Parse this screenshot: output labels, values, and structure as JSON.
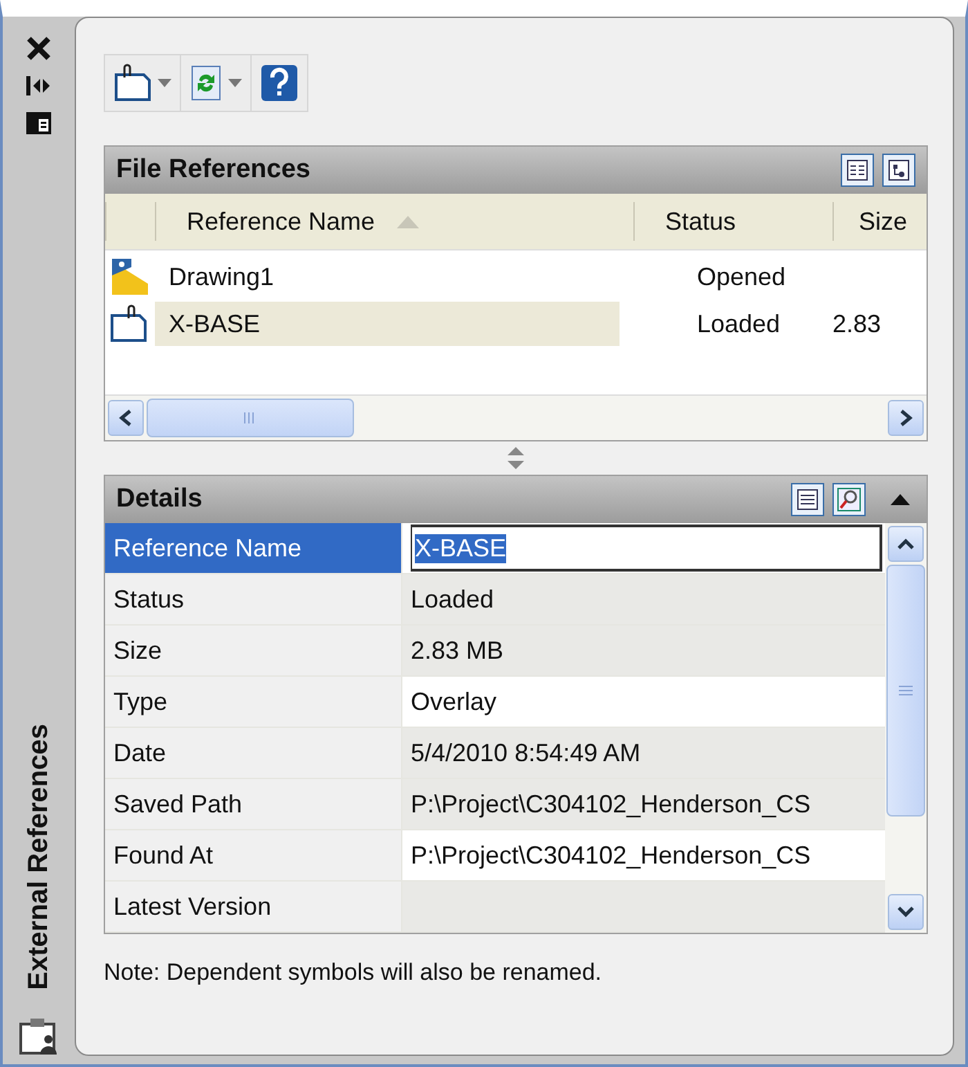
{
  "palette": {
    "title": "External References"
  },
  "toolbar": {
    "buttons": [
      {
        "kind": "attach",
        "dropdown": true
      },
      {
        "kind": "refresh",
        "dropdown": true
      },
      {
        "kind": "help",
        "dropdown": false
      }
    ]
  },
  "file_references": {
    "title": "File References",
    "columns": [
      {
        "label": "Reference Name",
        "sorted": true
      },
      {
        "label": "Status",
        "sorted": false
      },
      {
        "label": "Size",
        "sorted": false
      }
    ],
    "rows": [
      {
        "kind": "drawing",
        "name": "Drawing1",
        "status": "Opened",
        "size": "",
        "selected": false
      },
      {
        "kind": "xref",
        "name": "X-BASE",
        "status": "Loaded",
        "size": "2.83",
        "selected": true
      }
    ]
  },
  "details": {
    "title": "Details",
    "rows": [
      {
        "label": "Reference Name",
        "value": "X-BASE",
        "selected": true,
        "editable": true
      },
      {
        "label": "Status",
        "value": "Loaded",
        "selected": false,
        "editable": false
      },
      {
        "label": "Size",
        "value": "2.83 MB",
        "selected": false,
        "editable": false
      },
      {
        "label": "Type",
        "value": "Overlay",
        "selected": false,
        "editable": true
      },
      {
        "label": "Date",
        "value": "5/4/2010 8:54:49 AM",
        "selected": false,
        "editable": false
      },
      {
        "label": "Saved Path",
        "value": "P:\\Project\\C304102_Henderson_CS",
        "selected": false,
        "editable": false
      },
      {
        "label": "Found At",
        "value": "P:\\Project\\C304102_Henderson_CS",
        "selected": false,
        "editable": true
      },
      {
        "label": "Latest Version",
        "value": "",
        "selected": false,
        "editable": false
      }
    ]
  },
  "note": "Note: Dependent symbols will also be renamed."
}
